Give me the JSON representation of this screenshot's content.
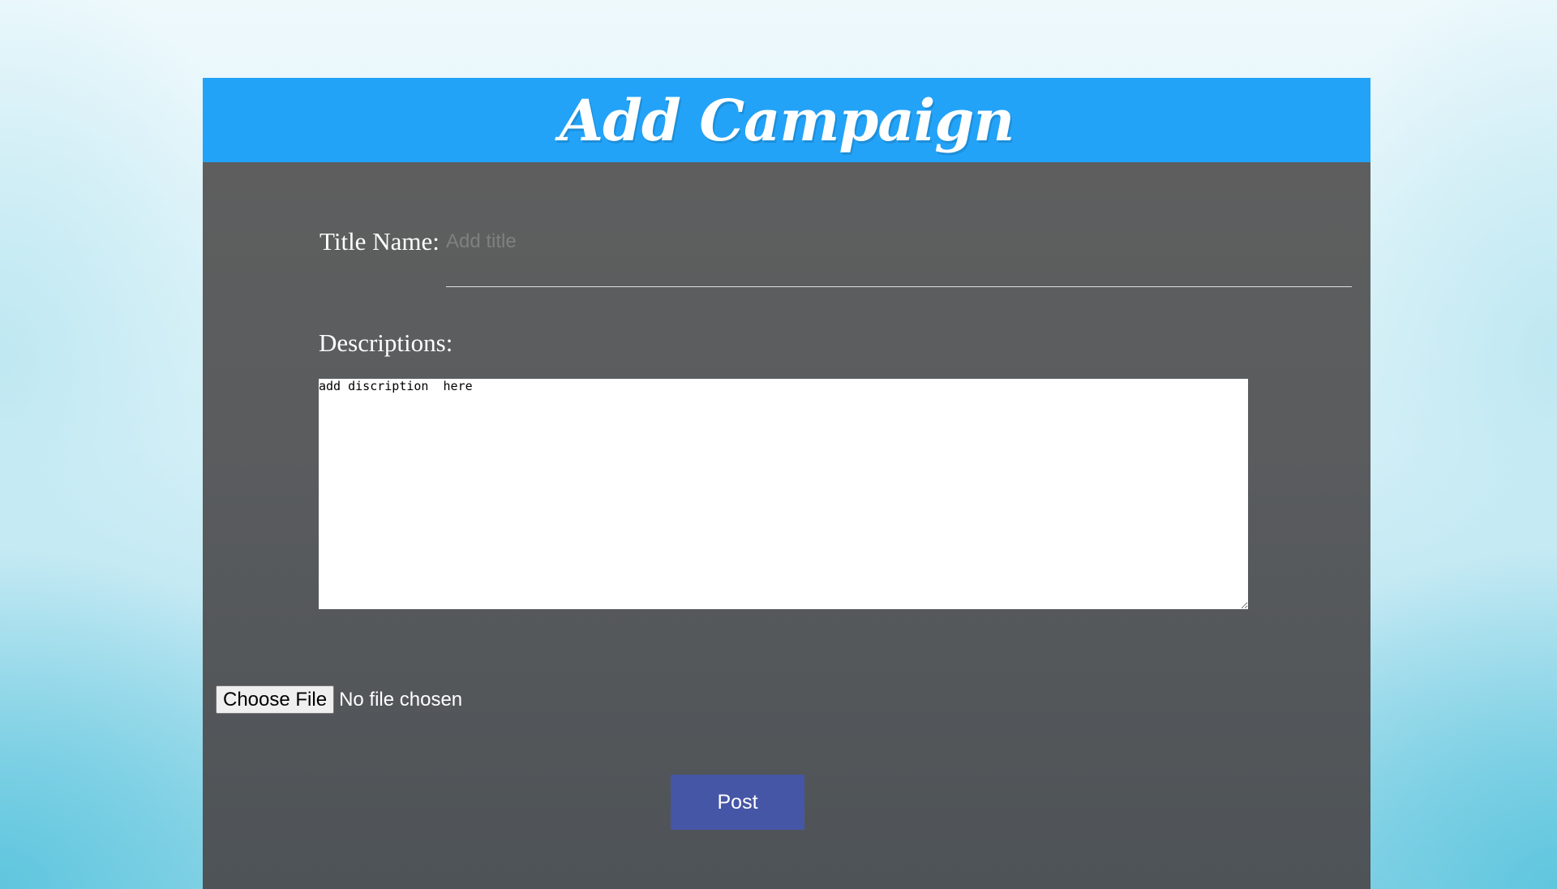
{
  "header": {
    "title": "Add Campaign"
  },
  "form": {
    "title_label": "Title Name:",
    "title_placeholder": "Add title",
    "title_value": "",
    "description_label": "Descriptions:",
    "description_value": "add discription  here",
    "file_button_label": "Choose File",
    "file_status": "No file chosen",
    "post_label": "Post"
  },
  "colors": {
    "banner": "#23a3f8",
    "panel": "#5f5f5f",
    "post_button": "#4656a6"
  }
}
